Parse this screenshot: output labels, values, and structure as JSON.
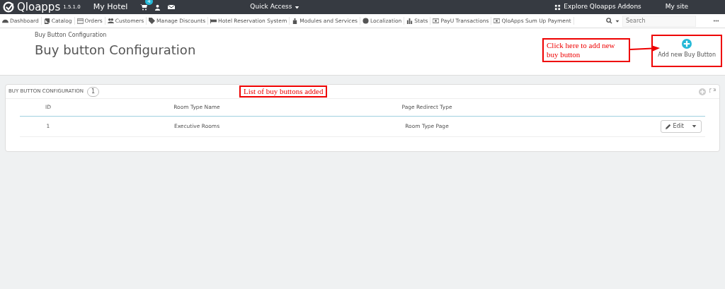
{
  "topbar": {
    "brand": "Qloapps",
    "version": "1.5.1.0",
    "shop": "My Hotel",
    "cart_count": "4",
    "quick_access": "Quick Access",
    "links": [
      "Explore Qloapps Addons",
      "My site"
    ]
  },
  "menu": {
    "items": [
      {
        "label": "Dashboard"
      },
      {
        "label": "Catalog"
      },
      {
        "label": "Orders"
      },
      {
        "label": "Customers"
      },
      {
        "label": "Manage Discounts"
      },
      {
        "label": "Hotel Reservation System"
      },
      {
        "label": "Modules and Services"
      },
      {
        "label": "Localization"
      },
      {
        "label": "Stats"
      },
      {
        "label": "PayU Transactions"
      },
      {
        "label": "QloApps Sum Up Payment"
      }
    ],
    "search": {
      "placeholder": "Search"
    }
  },
  "header": {
    "breadcrumb": "Buy Button Configuration",
    "title": "Buy button Configuration",
    "toolbar_button": "Add new Buy Button"
  },
  "panel": {
    "title": "BUY BUTTON CONFIGURATION",
    "count": "1",
    "columns": [
      "ID",
      "Room Type Name",
      "Page Redirect Type"
    ],
    "rows": [
      {
        "id": "1",
        "room_type": "Executive Rooms",
        "redirect": "Room Type Page",
        "action": "Edit"
      }
    ]
  },
  "annotations": [
    {
      "text": "Click here to add new buy button"
    },
    {
      "text": "List of buy buttons added"
    }
  ]
}
